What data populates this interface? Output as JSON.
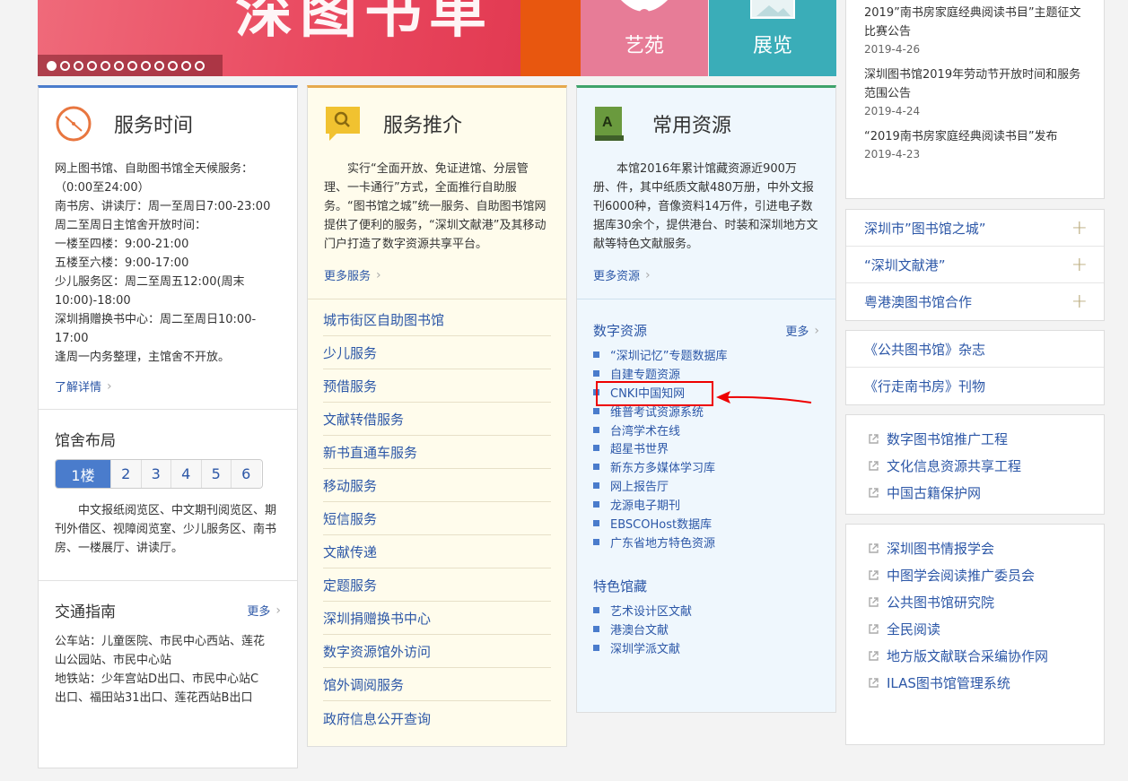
{
  "banner": {
    "ghost_text": "深图书单",
    "dot_count": 12,
    "active_dot": 1,
    "tiles": [
      {
        "label": "艺苑",
        "color": "#e77c97"
      },
      {
        "label": "展览",
        "color": "#3aadb8"
      }
    ]
  },
  "news": [
    {
      "title": "2019”南书房家庭经典阅读书目”主题征文比赛公告",
      "date": "2019-4-26"
    },
    {
      "title": "深圳图书馆2019年劳动节开放时间和服务范围公告",
      "date": "2019-4-24"
    },
    {
      "title": "“2019南书房家庭经典阅读书目”发布",
      "date": "2019-4-23"
    }
  ],
  "service_hours": {
    "title": "服务时间",
    "lines": [
      "网上图书馆、自助图书馆全天候服务：",
      "（0:00至24:00）",
      "南书房、讲读厅：周一至周日7:00-23:00",
      "周二至周日主馆舍开放时间：",
      "一楼至四楼：9:00-21:00",
      "五楼至六楼：9:00-17:00",
      "少儿服务区：周二至周五12:00(周末",
      "10:00)-18:00",
      "深圳捐赠换书中心：周二至周日10:00-",
      "17:00",
      "逢周一内务整理，主馆舍不开放。"
    ],
    "more": "了解详情"
  },
  "layout": {
    "title": "馆舍布局",
    "tabs": [
      "1楼",
      "2",
      "3",
      "4",
      "5",
      "6"
    ],
    "active_tab": "1楼",
    "text": "中文报纸阅览区、中文期刊阅览区、期刊外借区、视障阅览室、少儿服务区、南书房、一楼展厅、讲读厅。"
  },
  "traffic": {
    "title": "交通指南",
    "more": "更多",
    "lines": [
      "公车站：儿童医院、市民中心西站、莲花",
      "山公园站、市民中心站",
      "地铁站：少年宫站D出口、市民中心站C",
      "出口、福田站31出口、莲花西站B出口"
    ]
  },
  "services": {
    "title": "服务推介",
    "intro": "实行“全面开放、免证进馆、分层管理、一卡通行”方式，全面推行自助服务。“图书馆之城”统一服务、自助图书馆网提供了便利的服务，“深圳文献港”及其移动门户打造了数字资源共享平台。",
    "more": "更多服务",
    "items": [
      "城市街区自助图书馆",
      "少儿服务",
      "预借服务",
      "文献转借服务",
      "新书直通车服务",
      "移动服务",
      "短信服务",
      "文献传递",
      "定题服务",
      "深圳捐赠换书中心",
      "数字资源馆外访问",
      "馆外调阅服务",
      "政府信息公开查询"
    ]
  },
  "resources": {
    "title": "常用资源",
    "intro": "本馆2016年累计馆藏资源近900万册、件，其中纸质文献480万册，中外文报刊6000种，音像资料14万件，引进电子数据库30余个，提供港台、时装和深圳地方文献等特色文献服务。",
    "more": "更多资源",
    "digital_title": "数字资源",
    "digital_more": "更多",
    "digital": [
      "“深圳记忆”专题数据库",
      "自建专题资源",
      "CNKI中国知网",
      "维普考试资源系统",
      "台湾学术在线",
      "超星书世界",
      "新东方多媒体学习库",
      "网上报告厅",
      "龙源电子期刊",
      "EBSCOHost数据库",
      "广东省地方特色资源"
    ],
    "special_title": "特色馆藏",
    "special": [
      "艺术设计区文献",
      "港澳台文献",
      "深圳学派文献"
    ]
  },
  "accordion": [
    "深圳市”图书馆之城”",
    "“深圳文献港”",
    "粤港澳图书馆合作"
  ],
  "magazines": [
    "《公共图书馆》杂志",
    "《行走南书房》刊物"
  ],
  "links1": [
    "数字图书馆推广工程",
    "文化信息资源共享工程",
    "中国古籍保护网"
  ],
  "links2": [
    "深圳图书情报学会",
    "中图学会阅读推广委员会",
    "公共图书馆研究院",
    "全民阅读",
    "地方版文献联合采编协作网",
    "ILAS图书馆管理系统"
  ],
  "colors": {
    "accent_blue": "#4a7ccc",
    "link": "#2c57a7",
    "annotation_red": "#e00000"
  }
}
